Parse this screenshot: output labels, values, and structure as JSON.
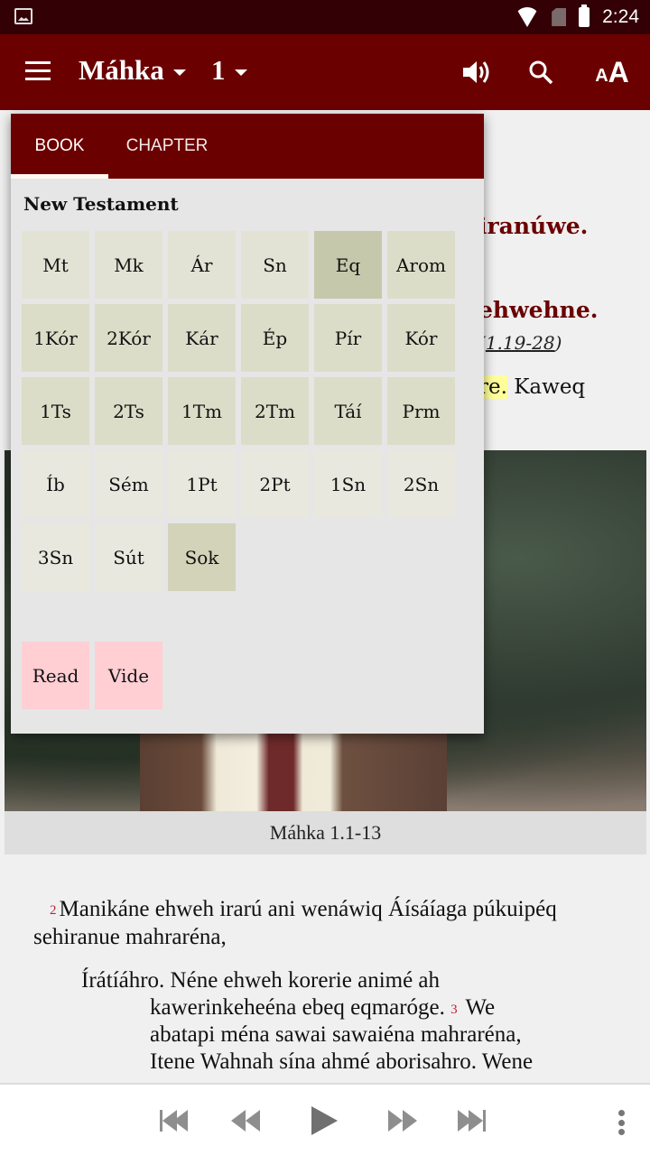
{
  "status_bar": {
    "time": "2:24",
    "icons": [
      "image-notification-icon",
      "wifi-icon",
      "no-sim-icon",
      "battery-icon"
    ]
  },
  "app_bar": {
    "book": "Máhka",
    "chapter": "1",
    "icons": [
      "menu-icon",
      "speaker-icon",
      "search-icon",
      "text-size-icon"
    ],
    "text_size_small": "A",
    "text_size_big": "A",
    "colors": {
      "primary": "#6b0000",
      "status": "#330005"
    }
  },
  "reader": {
    "heading1_partial": "iranúwe.",
    "heading2_partial": "ehwehne.",
    "xref_open": "(",
    "xref_link_partial": "1.19-28",
    "xref_close": ")",
    "partial_highlight": "re.",
    "partial_after": " Kaweq",
    "image_caption": "Máhka 1.1-13",
    "verse2_num": "2",
    "verse2_text": "Manikáne ehweh irarú ani wenáwiq Áísáíaga púkuipéq sehiranue mahraréna,",
    "poetry_line1": "Írátíáhro. Néne ehweh korerie animé ah",
    "poetry_line2": "kawerinkeheéna ebeq eqmaróge.",
    "verse3_num": "3",
    "poetry_line2b": " We",
    "poetry_line3": "abatapi ména sawai sawaiéna mahraréna,",
    "poetry_line4": "Itene Wahnah sína ahmé aborisahro. Wene"
  },
  "picker": {
    "tabs": [
      {
        "label": "BOOK",
        "active": true
      },
      {
        "label": "CHAPTER",
        "active": false
      }
    ],
    "section": "New Testament",
    "books": [
      {
        "abbr": "Mt",
        "group": "gospel"
      },
      {
        "abbr": "Mk",
        "group": "gospel"
      },
      {
        "abbr": "Ár",
        "group": "gospel"
      },
      {
        "abbr": "Sn",
        "group": "gospel"
      },
      {
        "abbr": "Eq",
        "group": "acts",
        "selected": true
      },
      {
        "abbr": "Arom",
        "group": "paul"
      },
      {
        "abbr": "1Kór",
        "group": "paul"
      },
      {
        "abbr": "2Kór",
        "group": "paul"
      },
      {
        "abbr": "Kár",
        "group": "paul"
      },
      {
        "abbr": "Ép",
        "group": "paul"
      },
      {
        "abbr": "Pír",
        "group": "paul"
      },
      {
        "abbr": "Kór",
        "group": "paul"
      },
      {
        "abbr": "1Ts",
        "group": "paul"
      },
      {
        "abbr": "2Ts",
        "group": "paul"
      },
      {
        "abbr": "1Tm",
        "group": "paul"
      },
      {
        "abbr": "2Tm",
        "group": "paul"
      },
      {
        "abbr": "Táí",
        "group": "paul"
      },
      {
        "abbr": "Prm",
        "group": "paul"
      },
      {
        "abbr": "Íb",
        "group": "general"
      },
      {
        "abbr": "Sém",
        "group": "general"
      },
      {
        "abbr": "1Pt",
        "group": "general"
      },
      {
        "abbr": "2Pt",
        "group": "general"
      },
      {
        "abbr": "1Sn",
        "group": "general"
      },
      {
        "abbr": "2Sn",
        "group": "general"
      },
      {
        "abbr": "3Sn",
        "group": "general"
      },
      {
        "abbr": "Sút",
        "group": "general"
      },
      {
        "abbr": "Sok",
        "group": "revelation",
        "selected": true
      }
    ],
    "extras": [
      {
        "label": "Read"
      },
      {
        "label": "Vide"
      }
    ],
    "colors": {
      "gospel": "#e3e3d5",
      "paul": "#dcddc8",
      "general": "#e8e8de",
      "selected": "#c6c8ac",
      "extras": "#ffcfd4"
    }
  },
  "player": {
    "controls": [
      "skip-to-start-icon",
      "rewind-icon",
      "play-icon",
      "fast-forward-icon",
      "skip-to-end-icon",
      "more-vertical-icon"
    ]
  }
}
